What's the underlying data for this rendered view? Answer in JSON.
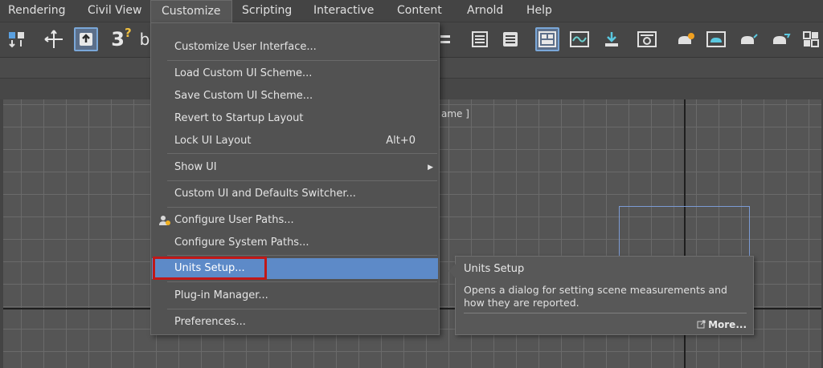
{
  "menubar": {
    "items": [
      {
        "label": "Rendering"
      },
      {
        "label": "Civil View"
      },
      {
        "label": "Customize"
      },
      {
        "label": "Scripting"
      },
      {
        "label": "Interactive"
      },
      {
        "label": "Content"
      },
      {
        "label": "Arnold"
      },
      {
        "label": "Help"
      }
    ]
  },
  "toolbar": {
    "icons": [
      "select-link-icon",
      "move-icon",
      "select-object-icon",
      "snap-3d-icon",
      "named-selection-icon",
      "layer-manager-icon",
      "scene-explorer-icon",
      "ribbon-toggle-icon",
      "curve-editor-icon",
      "schematic-view-icon",
      "material-editor-icon",
      "render-setup-icon",
      "rendered-frame-icon",
      "render-production-icon",
      "render-iterative-icon",
      "render-cloud-icon",
      "toolbar-grid-icon"
    ],
    "snap_label": "3",
    "snap_sup": "?"
  },
  "viewport": {
    "label": "ame ]"
  },
  "dropdown": {
    "items": [
      {
        "label": "Customize User Interface...",
        "shortcut": ""
      },
      {
        "label": "Load Custom UI Scheme...",
        "shortcut": ""
      },
      {
        "label": "Save Custom UI Scheme...",
        "shortcut": ""
      },
      {
        "label": "Revert to Startup Layout",
        "shortcut": ""
      },
      {
        "label": "Lock UI Layout",
        "shortcut": "Alt+0"
      },
      {
        "label": "Show UI",
        "shortcut": ""
      },
      {
        "label": "Custom UI and Defaults Switcher...",
        "shortcut": ""
      },
      {
        "label": "Configure User Paths...",
        "shortcut": ""
      },
      {
        "label": "Configure System Paths...",
        "shortcut": ""
      },
      {
        "label": "Units Setup...",
        "shortcut": ""
      },
      {
        "label": "Plug-in Manager...",
        "shortcut": ""
      },
      {
        "label": "Preferences...",
        "shortcut": ""
      }
    ],
    "submenu_arrow": "▶"
  },
  "tooltip": {
    "title": "Units Setup",
    "description": "Opens a dialog for setting scene measurements and how they are reported.",
    "more_label": "More..."
  },
  "colors": {
    "highlight": "#5d8ac8",
    "callout_border": "#c01818",
    "menu_bg": "#525252"
  }
}
